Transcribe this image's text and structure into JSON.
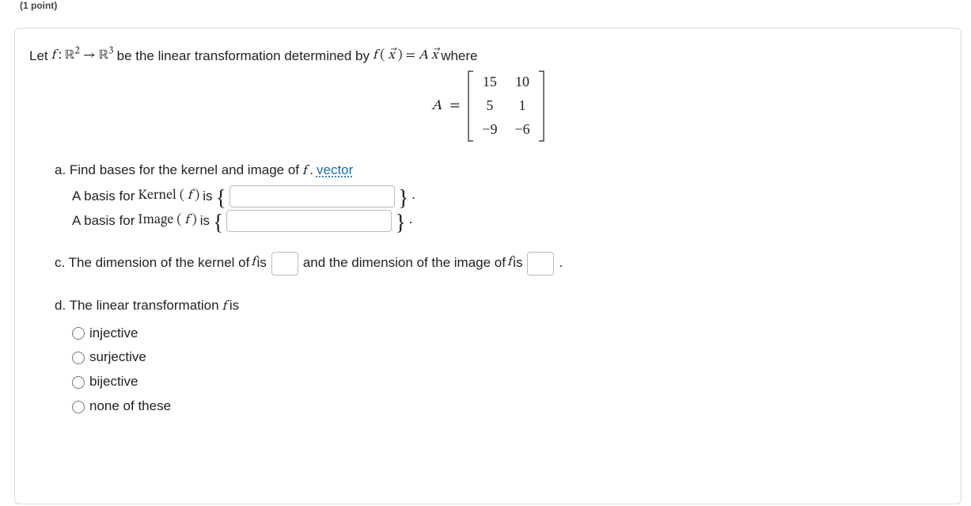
{
  "hint_label": "(1 point)",
  "intro": {
    "prefix": "Let ",
    "f": "f",
    "colon": " : ",
    "R": "ℝ",
    "exp_dom": "2",
    "arrow": " → ",
    "exp_codom": "3",
    "mid": " be the linear transformation determined by ",
    "fx_f": "f",
    "fx_open": "(",
    "fx_x": "x⃗",
    "fx_close": ")",
    "eq": " = ",
    "A": "A",
    "xvec": "x⃗",
    "suffix": " where"
  },
  "matrix": {
    "A": "A",
    "eq": "=",
    "rows": [
      [
        "15",
        "10"
      ],
      [
        "5",
        "1"
      ],
      [
        "−9",
        "−6"
      ]
    ]
  },
  "partA": {
    "label": "a. Find bases for the kernel and image of ",
    "f": "f",
    "period": ". ",
    "vector_link": "vector",
    "kernel_pre": "A basis for ",
    "kernel_fn": "Kernel",
    "kernel_open": "(",
    "kernel_f": "f",
    "kernel_close": ")",
    "is": " is ",
    "lbrace": "{",
    "rbrace": "}",
    "image_pre": "A basis for ",
    "image_fn": "Image",
    "image_open": "(",
    "image_f": "f",
    "image_close": ")",
    "period2": "."
  },
  "partC": {
    "label_pre": "c. The dimension of the kernel of ",
    "f": "f",
    "label_mid": " is ",
    "label_mid2": " and the dimension of the image of ",
    "f2": "f",
    "label_end": " is ",
    "period": "."
  },
  "partD": {
    "label": "d. The linear transformation ",
    "f": "f",
    "is": " is",
    "options": [
      "injective",
      "surjective",
      "bijective",
      "none of these"
    ]
  }
}
